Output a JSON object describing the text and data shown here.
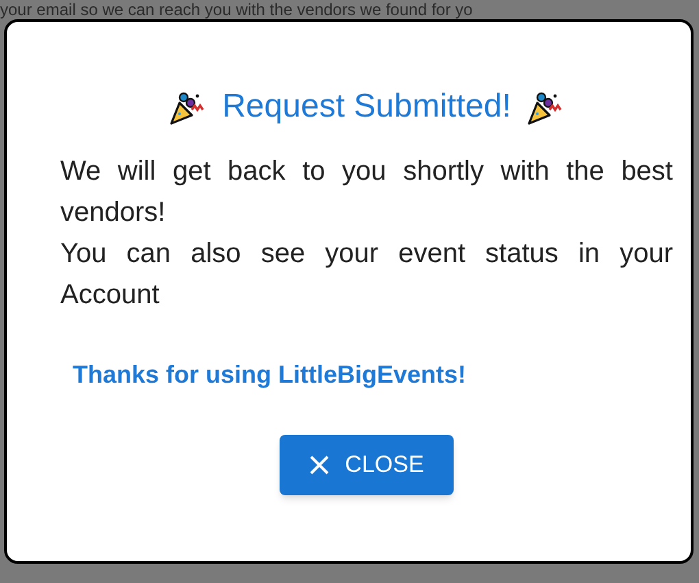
{
  "background_text": "your email so we can reach you with the vendors we found for yo",
  "dialog": {
    "title": "Request Submitted!",
    "paragraphs": [
      "We will get back to you shortly with the best vendors!",
      "You can also see your event status in your Account"
    ],
    "thanks": "Thanks for using LittleBigEvents!",
    "button": {
      "label": "CLOSE"
    }
  }
}
